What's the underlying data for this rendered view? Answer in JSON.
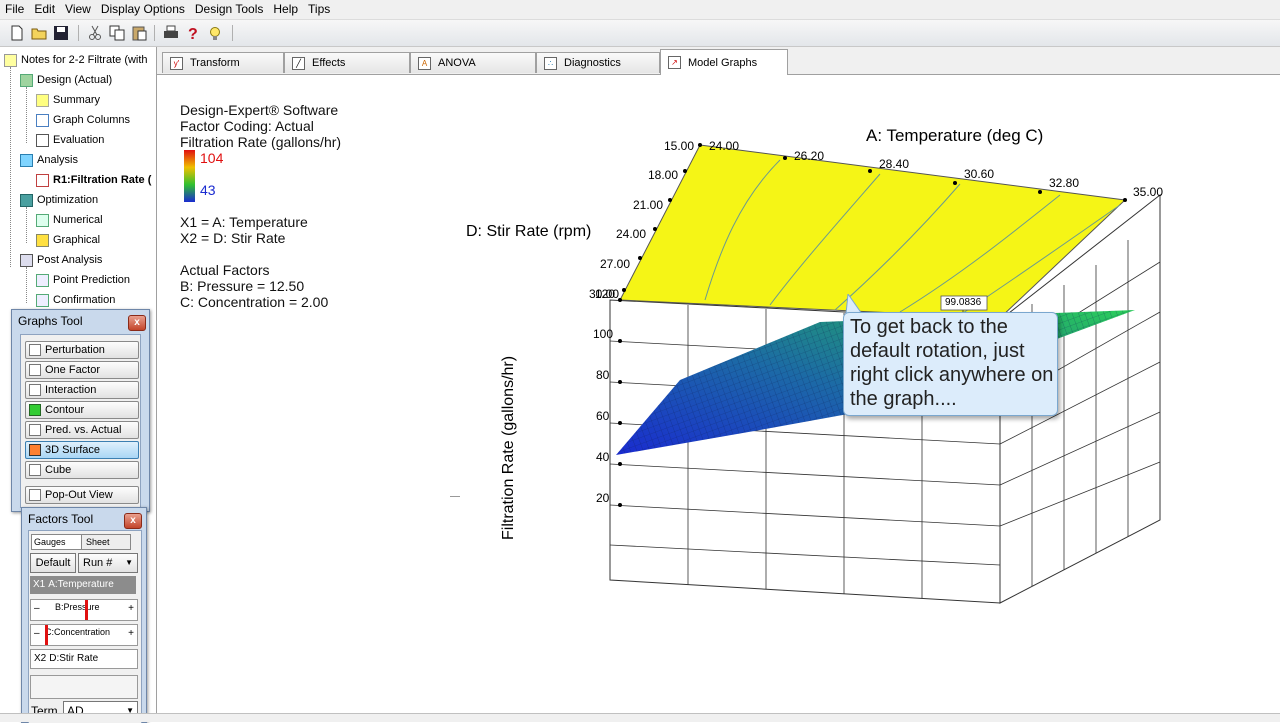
{
  "menu": [
    "File",
    "Edit",
    "View",
    "Display Options",
    "Design Tools",
    "Help",
    "Tips"
  ],
  "toolbar": {
    "icons": [
      "new-icon",
      "open-icon",
      "save-icon",
      "cut-icon",
      "copy-icon",
      "paste-icon",
      "print-icon",
      "help-icon",
      "tip-icon"
    ]
  },
  "tree": {
    "root": "Notes for 2-2 Filtrate (with",
    "design": "Design (Actual)",
    "summary": "Summary",
    "graph_columns": "Graph Columns",
    "evaluation": "Evaluation",
    "analysis": "Analysis",
    "response": "R1:Filtration Rate (",
    "optimization": "Optimization",
    "numerical": "Numerical",
    "graphical": "Graphical",
    "post_analysis": "Post Analysis",
    "point_prediction": "Point Prediction",
    "confirmation": "Confirmation"
  },
  "graphs_tool": {
    "title": "Graphs Tool",
    "close": "x",
    "buttons": [
      "Perturbation",
      "One Factor",
      "Interaction",
      "Contour",
      "Pred. vs. Actual",
      "3D Surface",
      "Cube"
    ],
    "selected": "3D Surface",
    "popout": "Pop-Out View"
  },
  "factors_tool": {
    "title": "Factors Tool",
    "close": "x",
    "gauges_tab": "Gauges",
    "sheet_tab": "Sheet",
    "default_btn": "Default",
    "run_select": "Run #",
    "x1_label": "X1",
    "x1_name": "A:Temperature",
    "minus": "–",
    "plus": "+",
    "pressure": "B:Pressure",
    "pressure_level": 0.5,
    "concentration": "C:Concentration",
    "concentration_level": 0.0,
    "x2_label": "X2",
    "x2_name": "D:Stir Rate",
    "term_label": "Term",
    "term_value": "AD"
  },
  "tabs": [
    "Transform",
    "Effects",
    "ANOVA",
    "Diagnostics",
    "Model Graphs"
  ],
  "active_tab": "Model Graphs",
  "info": {
    "software": "Design-Expert® Software",
    "coding": "Factor Coding: Actual",
    "response": "Filtration Rate (gallons/hr)",
    "high": "104",
    "low": "43",
    "x1": "X1 = A: Temperature",
    "x2": "X2 = D: Stir Rate",
    "actual_factors": "Actual Factors",
    "pressure": "B: Pressure = 12.50",
    "concentration": "C: Concentration = 2.00"
  },
  "graph": {
    "x_axis_title": "A: Temperature (deg C)",
    "y_axis_title": "D: Stir Rate (rpm)",
    "z_axis_title": "Filtration Rate (gallons/hr)",
    "x_ticks": [
      "24.00",
      "26.20",
      "28.40",
      "30.60",
      "32.80",
      "35.00"
    ],
    "y_ticks": [
      "15.00",
      "18.00",
      "21.00",
      "24.00",
      "27.00",
      "30.00"
    ],
    "z_ticks": [
      "120",
      "100",
      "80",
      "60",
      "40",
      "20"
    ],
    "point_label": "99.0836",
    "colors": {
      "high": "#e01010",
      "low": "#1a2bd0",
      "surface": "#f5f516"
    }
  },
  "callout": "To get back to the default rotation, just right click anywhere on the graph...."
}
